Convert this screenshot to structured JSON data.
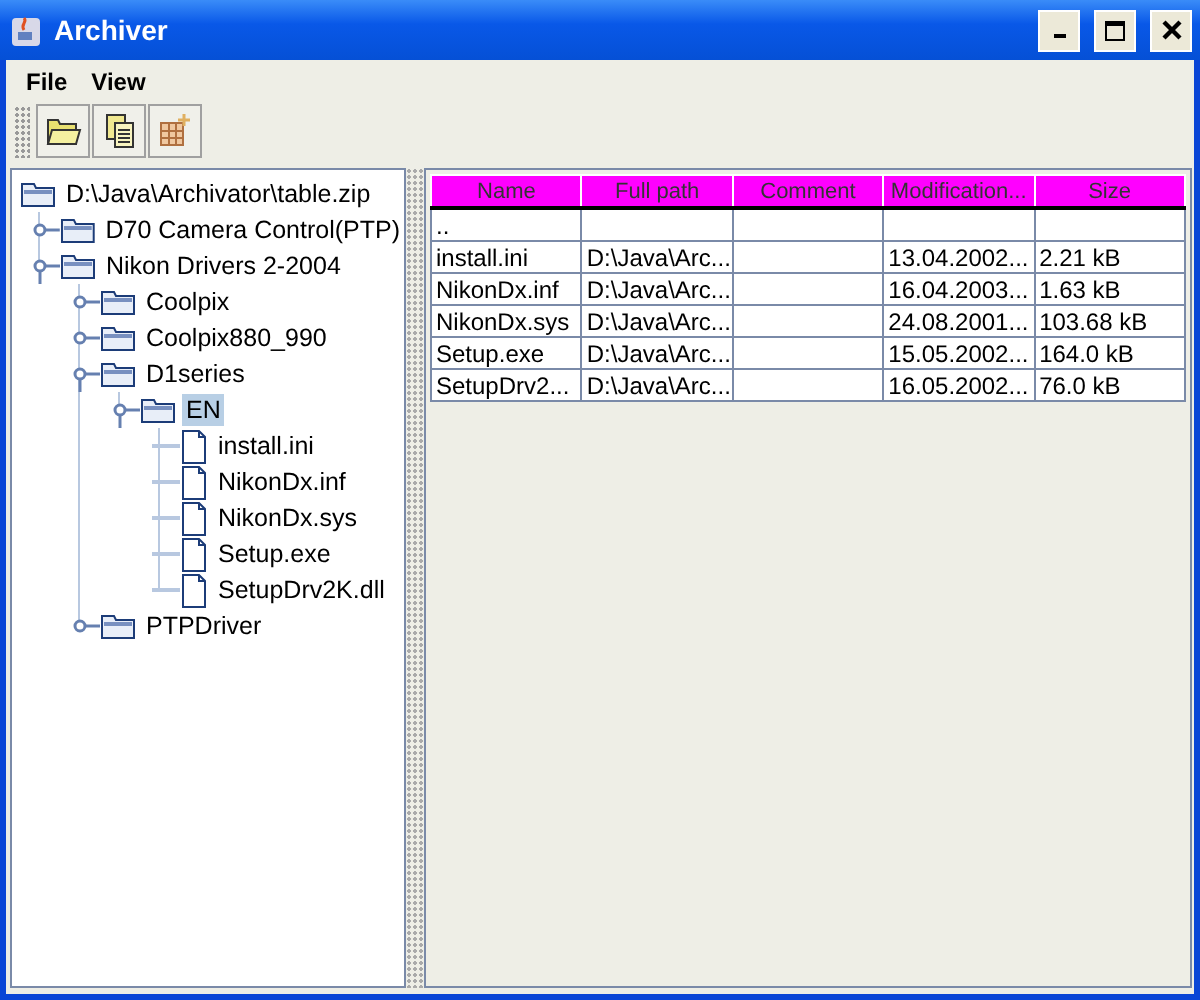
{
  "window": {
    "title": "Archiver"
  },
  "menu": [
    "File",
    "View"
  ],
  "toolbar": [
    {
      "kind": "open"
    },
    {
      "kind": "copy"
    },
    {
      "kind": "grid"
    }
  ],
  "tree": {
    "label": "D:\\Java\\Archivator\\table.zip",
    "kind": "folder",
    "selected": false,
    "children": [
      {
        "label": "D70 Camera Control(PTP)",
        "kind": "folder",
        "expanded": false,
        "selected": false
      },
      {
        "label": "Nikon Drivers 2-2004",
        "kind": "folder",
        "expanded": true,
        "selected": false,
        "children": [
          {
            "label": "Coolpix",
            "kind": "folder",
            "expanded": false,
            "selected": false
          },
          {
            "label": "Coolpix880_990",
            "kind": "folder",
            "expanded": false,
            "selected": false
          },
          {
            "label": "D1series",
            "kind": "folder",
            "expanded": true,
            "selected": false,
            "children": [
              {
                "label": "EN",
                "kind": "folder",
                "expanded": true,
                "selected": true,
                "children": [
                  {
                    "label": "install.ini",
                    "kind": "file",
                    "selected": false
                  },
                  {
                    "label": "NikonDx.inf",
                    "kind": "file",
                    "selected": false
                  },
                  {
                    "label": "NikonDx.sys",
                    "kind": "file",
                    "selected": false
                  },
                  {
                    "label": "Setup.exe",
                    "kind": "file",
                    "selected": false
                  },
                  {
                    "label": "SetupDrv2K.dll",
                    "kind": "file",
                    "selected": false
                  }
                ]
              }
            ]
          },
          {
            "label": "PTPDriver",
            "kind": "folder",
            "expanded": false,
            "selected": false
          }
        ]
      }
    ]
  },
  "table": {
    "columns": [
      "Name",
      "Full path",
      "Comment",
      "Modification...",
      "Size"
    ],
    "rows": [
      [
        "..",
        "",
        "",
        "",
        ""
      ],
      [
        "install.ini",
        "D:\\Java\\Arc...",
        "",
        "13.04.2002...",
        "2.21 kB"
      ],
      [
        "NikonDx.inf",
        "D:\\Java\\Arc...",
        "",
        "16.04.2003...",
        "1.63 kB"
      ],
      [
        "NikonDx.sys",
        "D:\\Java\\Arc...",
        "",
        "24.08.2001...",
        "103.68 kB"
      ],
      [
        "Setup.exe",
        "D:\\Java\\Arc...",
        "",
        "15.05.2002...",
        "164.0 kB"
      ],
      [
        "SetupDrv2...",
        "D:\\Java\\Arc...",
        "",
        "16.05.2002...",
        "76.0 kB"
      ]
    ]
  }
}
